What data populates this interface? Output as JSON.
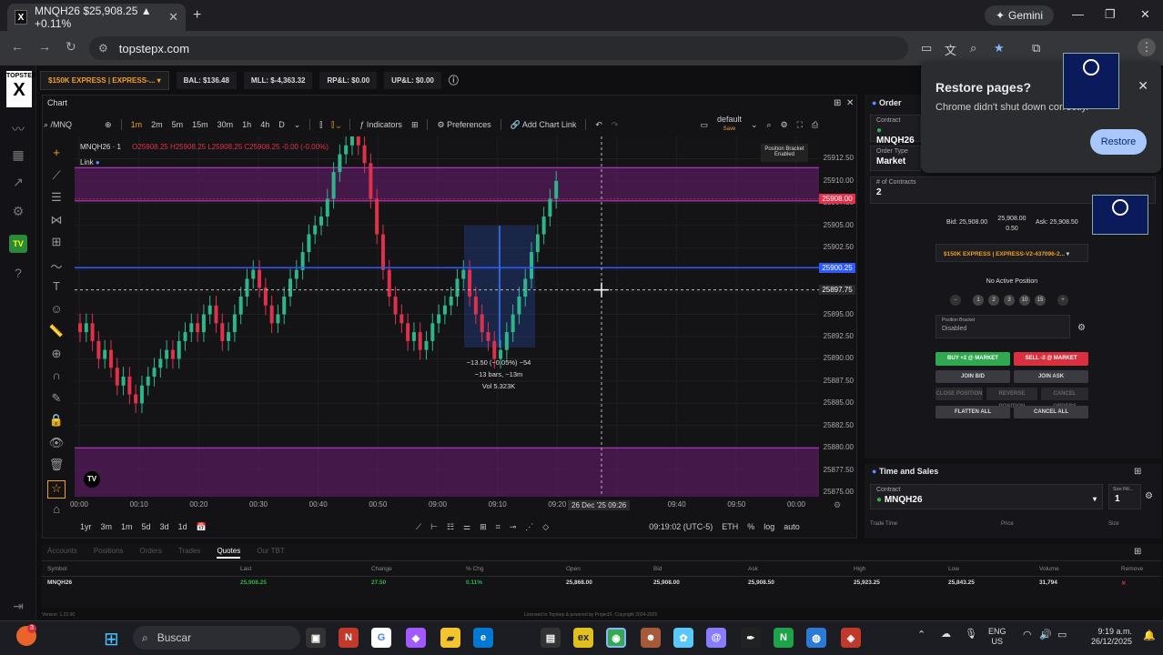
{
  "browser": {
    "tab_title": "MNQH26 $25,908.25 ▲ +0.11%",
    "tab_favicon": "X",
    "gemini_label": "Gemini",
    "url": "topstepx.com"
  },
  "app": {
    "logo_top": "TOPSTEP",
    "logo_letter": "X",
    "tv_badge": "TV",
    "account_selector": "$150K EXPRESS | EXPRESS-...",
    "stats": [
      "BAL: $136.48",
      "MLL: $-4,363.32",
      "RP&L: $0.00",
      "UP&L: $0.00"
    ]
  },
  "chart": {
    "panel_label": "Chart",
    "symbol_search": "/MNQ",
    "timeframes": [
      "1m",
      "2m",
      "5m",
      "15m",
      "30m",
      "1h",
      "4h",
      "D"
    ],
    "active_timeframe": "1m",
    "indicators_label": "Indicators",
    "preferences_label": "Preferences",
    "add_chart_link_label": "Add Chart Link",
    "layout_name": "default",
    "layout_sub": "Save",
    "legend_symbol": "MNQH26 · 1",
    "legend_ohlc": "O25908.25 H25908.25 L25908.25 C25908.25 -0.00 (-0.00%)",
    "link_label": "Link",
    "position_bracket": [
      "Position Bracket",
      "Enabled"
    ],
    "measure_lines": [
      "−13.50 (−0.05%) −54",
      "−13 bars, −13m",
      "Vol 5.323K"
    ],
    "date_tag": "26 Dec '25  09:26",
    "bottom_ranges": [
      "1yr",
      "3m",
      "1m",
      "5d",
      "3d",
      "1d"
    ],
    "bottom_right": [
      "09:19:02 (UTC-5)",
      "ETH",
      "%",
      "log",
      "auto"
    ]
  },
  "chart_data": {
    "type": "candlestick",
    "title": "",
    "xlabel": "",
    "ylabel": "",
    "x_ticks": [
      "00:00",
      "00:10",
      "00:20",
      "00:30",
      "00:40",
      "00:50",
      "09:00",
      "09:10",
      "09:20",
      "09:30",
      "09:40",
      "09:50",
      "00:00"
    ],
    "y_ticks": [
      25912.5,
      25910.0,
      25907.5,
      25905.0,
      25902.5,
      25900.0,
      25897.5,
      25895.0,
      25892.5,
      25890.0,
      25887.5,
      25885.0,
      25882.5,
      25880.0,
      25877.5,
      25875.0
    ],
    "y_tick_labels": [
      "25912.50",
      "25910.00",
      "25907.50",
      "25905.00",
      "25902.50",
      "25900.00",
      "25897.50",
      "25895.00",
      "25892.50",
      "25890.00",
      "25887.50",
      "25885.00",
      "25882.50",
      "25880.00",
      "25877.50",
      "25875.00"
    ],
    "ylim": [
      25874.5,
      25915.0
    ],
    "price_tags": [
      {
        "label": "25908.00",
        "value": 25908.0,
        "color": "#e0314b"
      },
      {
        "label": "25900.25",
        "value": 25900.25,
        "color": "#2d5bff"
      },
      {
        "label": "25897.75",
        "value": 25897.75,
        "color": "#2a2a2e"
      }
    ],
    "zone_upper": [
      25907.75,
      25911.5
    ],
    "zone_lower": [
      25874.5,
      25880.0
    ],
    "closes": [
      25893,
      25894,
      25892,
      25890,
      25891,
      25889,
      25887,
      25888,
      25886,
      25885,
      25887,
      25888,
      25889,
      25890,
      25891,
      25890,
      25892,
      25893,
      25894,
      25893,
      25895,
      25896,
      25894,
      25892,
      25893,
      25895,
      25897,
      25899,
      25900,
      25898,
      25896,
      25894,
      25895,
      25897,
      25899,
      25900,
      25902,
      25904,
      25905,
      25906,
      25908,
      25911,
      25913,
      25914,
      25915,
      25914,
      25912,
      25908,
      25904,
      25900,
      25897,
      25895,
      25894,
      25892,
      25893,
      25891,
      25892,
      25894,
      25895,
      25896,
      25897,
      25899,
      25900,
      25897,
      25895,
      25893,
      25892,
      25890,
      25891,
      25893,
      25895,
      25897,
      25899,
      25902,
      25904,
      25906,
      25908,
      25910
    ]
  },
  "order_panel": {
    "title": "Order",
    "contract_label": "Contract",
    "contract_value": "MNQH26",
    "order_type_label": "Order Type",
    "order_type_value": "Market",
    "contracts_label": "# of Contracts",
    "contracts_value": "2",
    "bid": "Bid: 25,908.00",
    "mid": "25,908.00",
    "spread": "0.50",
    "ask": "Ask: 25,908.50",
    "account_selector": "$150K EXPRESS | EXPRESS-V2-437096-2...",
    "no_position": "No Active Position",
    "size_buttons": [
      "−",
      "1",
      "2",
      "3",
      "10",
      "15",
      "+"
    ],
    "bracket_label": "Position Bracket",
    "bracket_value": "Disabled",
    "buy_label": "BUY +2 @ MARKET",
    "sell_label": "SELL -2 @ MARKET",
    "join_bid": "JOIN BID",
    "join_ask": "JOIN ASK",
    "close_position": "CLOSE POSITION",
    "reverse_position": "REVERSE POSITION",
    "cancel_orders": "CANCEL ORDERS",
    "flatten_all": "FLATTEN ALL",
    "cancel_all": "CANCEL ALL"
  },
  "restore_popup": {
    "title": "Restore pages?",
    "message": "Chrome didn't shut down correctly.",
    "button": "Restore"
  },
  "time_sales": {
    "title": "Time and Sales",
    "contract_label": "Contract",
    "contract_value": "MNQH26",
    "size_filter_label": "Size Filt...",
    "size_filter_value": "1",
    "cols": [
      "Trade Time",
      "Price",
      "Size"
    ]
  },
  "bottom": {
    "tabs": [
      "Accounts",
      "Positions",
      "Orders",
      "Trades",
      "Quotes",
      "Our TBT"
    ],
    "active_tab": "Quotes",
    "headers": [
      "Symbol",
      "Last",
      "Change",
      "% Chg",
      "Open",
      "Bid",
      "Ask",
      "High",
      "Low",
      "Volume",
      "Remove"
    ],
    "row": [
      "MNQH26",
      "25,908.25",
      "27.50",
      "0.11%",
      "25,868.00",
      "25,908.00",
      "25,908.50",
      "25,923.25",
      "25,843.25",
      "31,794",
      "✕"
    ],
    "footer_left": "Version: 1.22.00",
    "footer_center": "Licensed to Topstep & powered by ProjectX. Copyright 2024-2025"
  },
  "taskbar": {
    "search_placeholder": "Buscar",
    "notif_count": "3",
    "lang": [
      "ENG",
      "US"
    ],
    "time": "9:19 a.m.",
    "date": "26/12/2025"
  }
}
